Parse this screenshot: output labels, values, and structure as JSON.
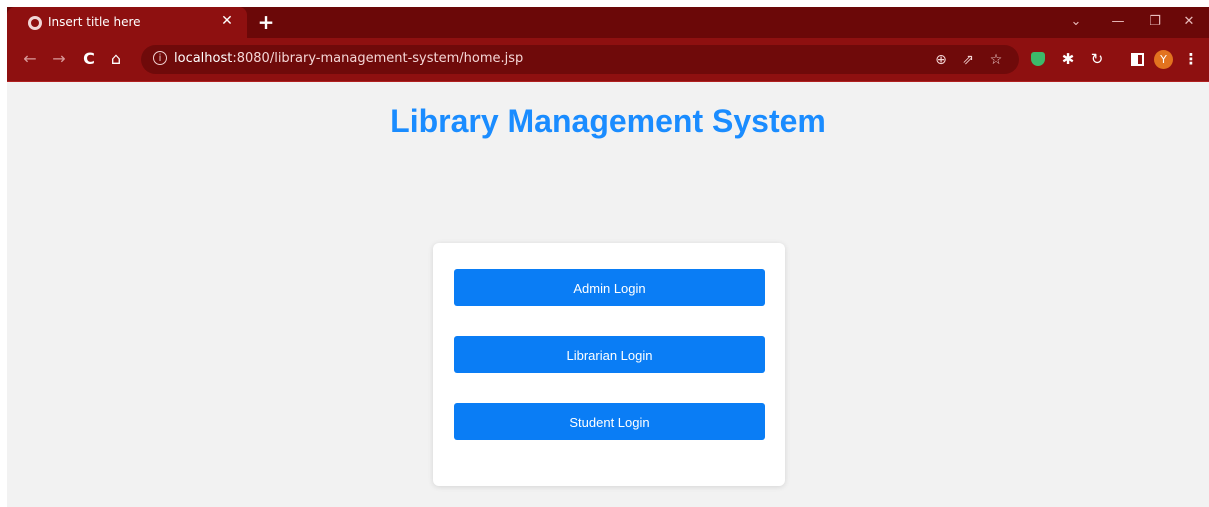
{
  "browser": {
    "tab_title": "Insert title here",
    "tab_close": "✕",
    "new_tab": "+",
    "window_controls": {
      "dropdown": "⌄",
      "minimize": "—",
      "restore": "❐",
      "close": "✕"
    },
    "nav": {
      "back": "←",
      "forward": "→",
      "reload": "C",
      "home": "⌂"
    },
    "address": {
      "info_icon": "i",
      "host": "localhost",
      "rest": ":8080/library-management-system/home.jsp"
    },
    "omnibox_icons": {
      "zoom": "⊕",
      "share": "⇗",
      "bookmark": "☆"
    },
    "extensions": {
      "puzzle": "✱",
      "sync": "↻"
    },
    "profile_initial": "Y",
    "menu": "⋮"
  },
  "page": {
    "title": "Library Management System",
    "buttons": {
      "admin_login": "Admin Login",
      "librarian_login": "Librarian Login",
      "student_login": "Student Login"
    }
  },
  "colors": {
    "title": "#1a8cff",
    "button": "#0a7df5",
    "chrome_dark": "#6b0808",
    "chrome": "#8e1010",
    "page_bg": "#f2f2f2"
  }
}
